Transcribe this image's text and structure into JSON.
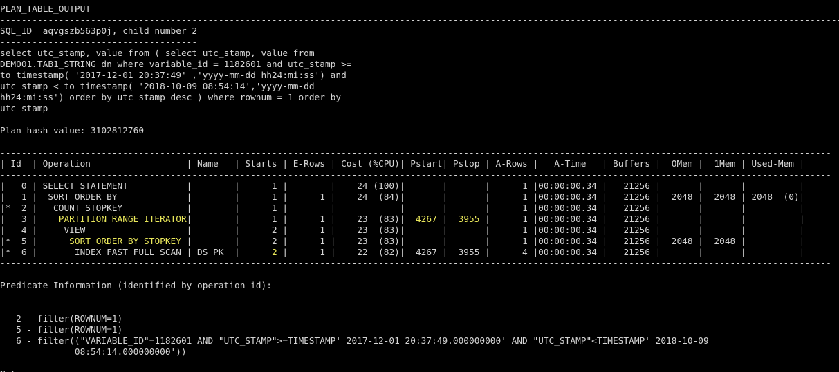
{
  "colors": {
    "background": "#000000",
    "text": "#d4d4d4",
    "highlight": "#e8e65a"
  },
  "lines": [
    {
      "segments": [
        {
          "text": "PLAN_TABLE_OUTPUT"
        }
      ]
    },
    {
      "segments": [
        {
          "text": "--------------------------------------------------------------------------------------------------------------------------------------------------------------------------------------------------------------------------"
        }
      ]
    },
    {
      "segments": [
        {
          "text": "SQL_ID  aqvgszb563p0j, child number 2"
        }
      ]
    },
    {
      "segments": [
        {
          "text": "-------------------------------------"
        }
      ]
    },
    {
      "segments": [
        {
          "text": "select utc_stamp, value from ( select utc_stamp, value from"
        }
      ]
    },
    {
      "segments": [
        {
          "text": "DEMO01.TAB1_STRING dn where variable_id = 1182601 and utc_stamp >="
        }
      ]
    },
    {
      "segments": [
        {
          "text": "to_timestamp( '2017-12-01 20:37:49' ,'yyyy-mm-dd hh24:mi:ss') and"
        }
      ]
    },
    {
      "segments": [
        {
          "text": "utc_stamp < to_timestamp( '2018-10-09 08:54:14','yyyy-mm-dd"
        }
      ]
    },
    {
      "segments": [
        {
          "text": "hh24:mi:ss') order by utc_stamp desc ) where rownum = 1 order by"
        }
      ]
    },
    {
      "segments": [
        {
          "text": "utc_stamp"
        }
      ]
    },
    {
      "segments": [
        {
          "text": ""
        }
      ]
    },
    {
      "segments": [
        {
          "text": "Plan hash value: 3102812760"
        }
      ]
    },
    {
      "segments": [
        {
          "text": ""
        }
      ]
    },
    {
      "segments": [
        {
          "text": "------------------------------------------------------------------------------------------------------------------------------------------------------------"
        }
      ]
    },
    {
      "segments": [
        {
          "text": "| Id  | Operation                  | Name   | Starts | E-Rows | Cost (%CPU)| Pstart| Pstop | A-Rows |   A-Time   | Buffers |  OMem |  1Mem | Used-Mem |"
        }
      ]
    },
    {
      "segments": [
        {
          "text": "------------------------------------------------------------------------------------------------------------------------------------------------------------"
        }
      ]
    },
    {
      "segments": [
        {
          "text": "|   0 | SELECT STATEMENT           |        |      1 |        |    24 (100)|       |       |      1 |00:00:00.34 |   21256 |       |       |          |"
        }
      ]
    },
    {
      "segments": [
        {
          "text": "|   1 |  SORT ORDER BY             |        |      1 |      1 |    24  (84)|       |       |      1 |00:00:00.34 |   21256 |  2048 |  2048 | 2048  (0)|"
        }
      ]
    },
    {
      "segments": [
        {
          "text": "|*  2 |   COUNT STOPKEY            |        |      1 |        |            |       |       |      1 |00:00:00.34 |   21256 |       |       |          |"
        }
      ]
    },
    {
      "segments": [
        {
          "text": "|   3 |    "
        },
        {
          "text": "PARTITION RANGE ITERATOR",
          "hl": true
        },
        {
          "text": "|        |      1 |      1 |    23  (83)|  "
        },
        {
          "text": "4267",
          "hl": true
        },
        {
          "text": " |  "
        },
        {
          "text": "3955",
          "hl": true
        },
        {
          "text": " |      1 |00:00:00.34 |   21256 |       |       |          |"
        }
      ]
    },
    {
      "segments": [
        {
          "text": "|   4 |     VIEW                   |        |      2 |      1 |    23  (83)|       |       |      1 |00:00:00.34 |   21256 |       |       |          |"
        }
      ]
    },
    {
      "segments": [
        {
          "text": "|*  5 |      "
        },
        {
          "text": "SORT ORDER BY STOPKEY",
          "hl": true
        },
        {
          "text": " |        |      2 |      1 |    23  (83)|       |       |      1 |00:00:00.34 |   21256 |  2048 |  2048 |          |"
        }
      ]
    },
    {
      "segments": [
        {
          "text": "|*  6 |       INDEX FAST FULL SCAN | DS_PK  |      "
        },
        {
          "text": "2",
          "hl": true
        },
        {
          "text": " |      1 |    22  (82)|  4267 |  3955 |      4 |00:00:00.34 |   21256 |       |       |          |"
        }
      ]
    },
    {
      "segments": [
        {
          "text": "------------------------------------------------------------------------------------------------------------------------------------------------------------"
        }
      ]
    },
    {
      "segments": [
        {
          "text": ""
        }
      ]
    },
    {
      "segments": [
        {
          "text": "Predicate Information (identified by operation id):"
        }
      ]
    },
    {
      "segments": [
        {
          "text": "---------------------------------------------------"
        }
      ]
    },
    {
      "segments": [
        {
          "text": ""
        }
      ]
    },
    {
      "segments": [
        {
          "text": "   2 - filter(ROWNUM=1)"
        }
      ]
    },
    {
      "segments": [
        {
          "text": "   5 - filter(ROWNUM=1)"
        }
      ]
    },
    {
      "segments": [
        {
          "text": "   6 - filter((\"VARIABLE_ID\"=1182601 AND \"UTC_STAMP\">=TIMESTAMP' 2017-12-01 20:37:49.000000000' AND \"UTC_STAMP\"<TIMESTAMP' 2018-10-09"
        }
      ]
    },
    {
      "segments": [
        {
          "text": "              08:54:14.000000000'))"
        }
      ]
    },
    {
      "segments": [
        {
          "text": ""
        }
      ]
    },
    {
      "segments": [
        {
          "text": "Note"
        }
      ]
    }
  ]
}
